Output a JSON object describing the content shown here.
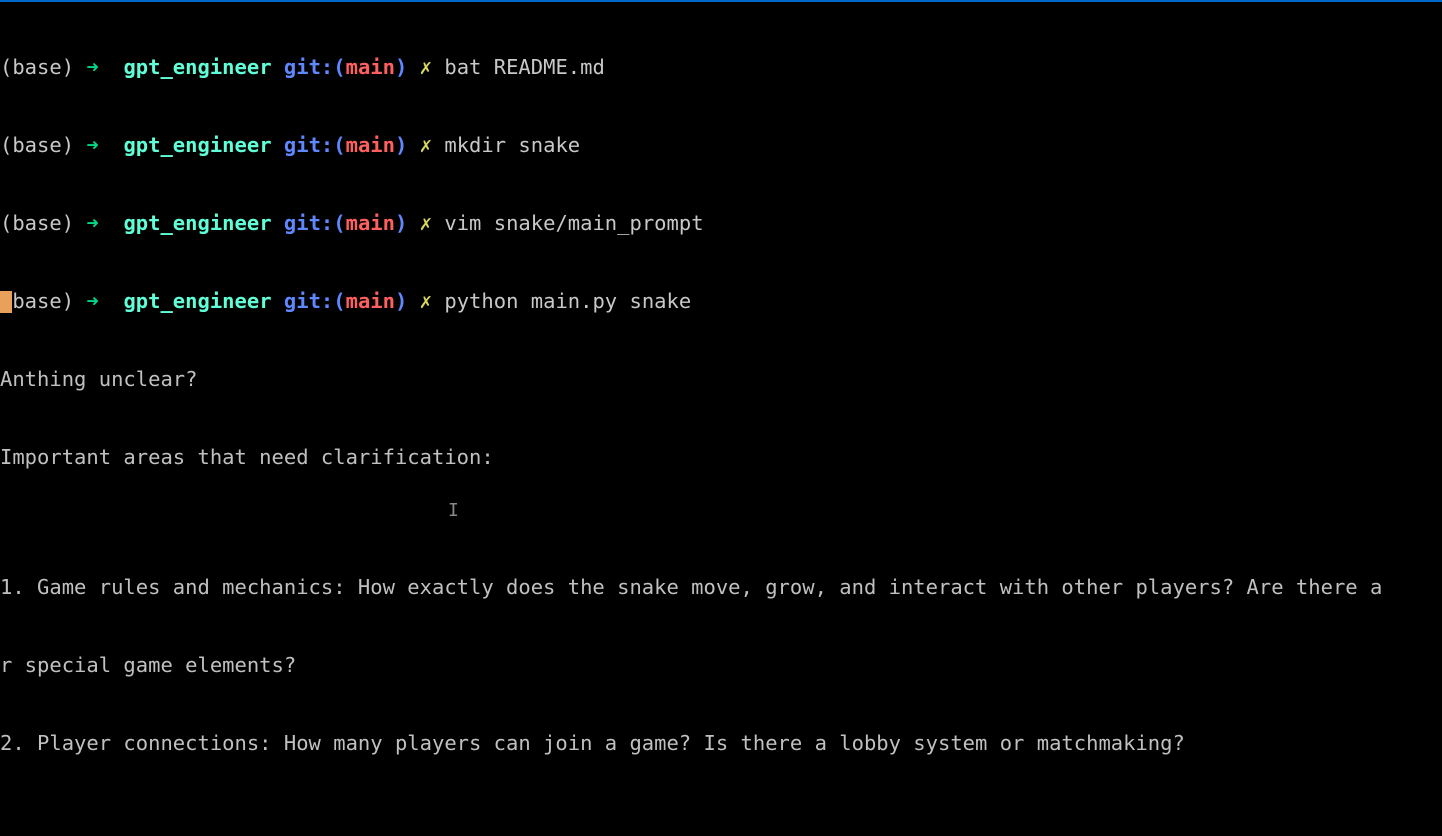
{
  "prompt": {
    "env": "(base)",
    "arrow": "➜",
    "dir": "gpt_engineer",
    "git_label": "git:",
    "git_paren_open": "(",
    "git_branch": "main",
    "git_paren_close": ")",
    "git_dirty": "✗"
  },
  "commands": [
    "bat README.md",
    "mkdir snake",
    "vim snake/main_prompt",
    "python main.py snake"
  ],
  "output": {
    "line1": "Anthing unclear?",
    "line2": "Important areas that need clarification:",
    "blank1": "",
    "item1": "1. Game rules and mechanics: How exactly does the snake move, grow, and interact with other players? Are there a",
    "item1_cont": "r special game elements?",
    "item2": "2. Player connections: How many players can join a game? Is there a lobby system or matchmaking?"
  },
  "text_cursor_glyph": "I"
}
